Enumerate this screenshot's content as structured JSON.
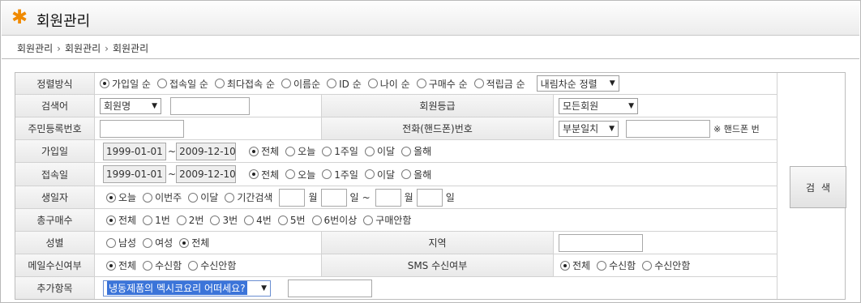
{
  "app": {
    "title": "회원관리",
    "breadcrumb": [
      "회원관리",
      "회원관리",
      "회원관리"
    ]
  },
  "rows": {
    "sort": {
      "label": "정렬방식",
      "options": [
        "가입일 순",
        "접속일 순",
        "최다접속 순",
        "이름순",
        "ID 순",
        "나이 순",
        "구매수 순",
        "적립금 순"
      ],
      "selected": "가입일 순",
      "order_select": "내림차순 정렬"
    },
    "keyword": {
      "label": "검색어",
      "select_value": "회원명",
      "input_value": ""
    },
    "grade": {
      "label": "회원등급",
      "select_value": "모든회원"
    },
    "resident": {
      "label": "주민등록번호",
      "input_value": ""
    },
    "phone": {
      "label": "전화(핸드폰)번호",
      "select_value": "부분일치",
      "input_value": "",
      "note": "※ 핸드폰 번"
    },
    "join": {
      "label": "가입일",
      "from": "1999-01-01",
      "to": "2009-12-10",
      "options": [
        "전체",
        "오늘",
        "1주일",
        "이달",
        "올해"
      ],
      "selected": "전체"
    },
    "access": {
      "label": "접속일",
      "from": "1999-01-01",
      "to": "2009-12-10",
      "options": [
        "전체",
        "오늘",
        "1주일",
        "이달",
        "올해"
      ],
      "selected": "전체"
    },
    "birthday": {
      "label": "생일자",
      "options": [
        "오늘",
        "이번주",
        "이달",
        "기간검색"
      ],
      "selected": "오늘",
      "month_unit": "월",
      "day_unit": "일",
      "tilde": "~"
    },
    "purchase": {
      "label": "총구매수",
      "options": [
        "전체",
        "1번",
        "2번",
        "3번",
        "4번",
        "5번",
        "6번이상",
        "구매안함"
      ],
      "selected": "전체"
    },
    "gender": {
      "label": "성별",
      "options": [
        "남성",
        "여성",
        "전체"
      ],
      "selected": "전체"
    },
    "region": {
      "label": "지역",
      "input_value": ""
    },
    "mail": {
      "label": "메일수신여부",
      "options": [
        "전체",
        "수신함",
        "수신안함"
      ],
      "selected": "전체"
    },
    "sms": {
      "label": "SMS 수신여부",
      "options": [
        "전체",
        "수신함",
        "수신안함"
      ],
      "selected": "전체"
    },
    "extra": {
      "label": "추가항목",
      "select_value": "냉동제품의 멕시코요리 어떠세요?",
      "input_value": ""
    }
  },
  "search_button": "검색",
  "colors": {
    "accent": "#f08a00",
    "select_highlight": "#3b74d9"
  }
}
